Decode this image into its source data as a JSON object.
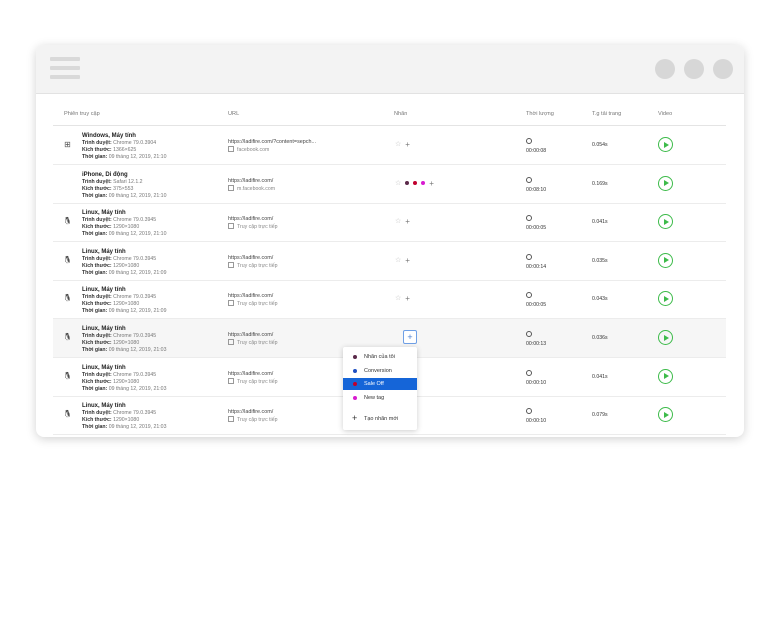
{
  "columns": [
    "Phiên truy cập",
    "URL",
    "Nhãn",
    "Thời lượng",
    "T.g tải trang",
    "Video"
  ],
  "rows": [
    {
      "os": "windows",
      "title": "Windows, Máy tính",
      "browser_label": "Trình duyệt:",
      "browser": "Chrome 79.0.3904",
      "size_label": "Kích thước:",
      "size": "1366×625",
      "time_label": "Thời gian:",
      "time": "09 tháng 12, 2019, 21:10",
      "url": "https://ladifire.com/?content=sepch...",
      "source": "facebook.com",
      "tags": [],
      "duration": "00:00:08",
      "load": "0.054s"
    },
    {
      "os": "apple",
      "title": "iPhone, Di động",
      "browser_label": "Trình duyệt:",
      "browser": "Safari 12.1.2",
      "size_label": "Kích thước:",
      "size": "375×553",
      "time_label": "Thời gian:",
      "time": "09 tháng 12, 2019, 21:10",
      "url": "https://ladifire.com/",
      "source": "m.facebook.com",
      "tags": [
        "#5b2a4a",
        "#c0002e",
        "#d81bd0"
      ],
      "duration": "00:08:10",
      "load": "0.169s"
    },
    {
      "os": "linux",
      "title": "Linux, Máy tính",
      "browser_label": "Trình duyệt:",
      "browser": "Chrome 79.0.3945",
      "size_label": "Kích thước:",
      "size": "1290×1080",
      "time_label": "Thời gian:",
      "time": "09 tháng 12, 2019, 21:10",
      "url": "https://ladifire.com/",
      "source": "Truy cập trực tiếp",
      "tags": [],
      "duration": "00:00:05",
      "load": "0.041s"
    },
    {
      "os": "linux",
      "title": "Linux, Máy tính",
      "browser_label": "Trình duyệt:",
      "browser": "Chrome 79.0.3945",
      "size_label": "Kích thước:",
      "size": "1290×1080",
      "time_label": "Thời gian:",
      "time": "09 tháng 12, 2019, 21:09",
      "url": "https://ladifire.com/",
      "source": "Truy cập trực tiếp",
      "tags": [],
      "duration": "00:00:14",
      "load": "0.035s"
    },
    {
      "os": "linux",
      "title": "Linux, Máy tính",
      "browser_label": "Trình duyệt:",
      "browser": "Chrome 79.0.3945",
      "size_label": "Kích thước:",
      "size": "1290×1080",
      "time_label": "Thời gian:",
      "time": "09 tháng 12, 2019, 21:09",
      "url": "https://ladifire.com/",
      "source": "Truy cập trực tiếp",
      "tags": [],
      "duration": "00:00:05",
      "load": "0.043s"
    },
    {
      "os": "linux",
      "title": "Linux, Máy tính",
      "browser_label": "Trình duyệt:",
      "browser": "Chrome 79.0.3945",
      "size_label": "Kích thước:",
      "size": "1290×1080",
      "time_label": "Thời gian:",
      "time": "09 tháng 12, 2019, 21:03",
      "url": "https://ladifire.com/",
      "source": "Truy cập trực tiếp",
      "tags": [],
      "duration": "00:00:13",
      "load": "0.036s",
      "highlighted": true
    },
    {
      "os": "linux",
      "title": "Linux, Máy tính",
      "browser_label": "Trình duyệt:",
      "browser": "Chrome 79.0.3945",
      "size_label": "Kích thước:",
      "size": "1290×1080",
      "time_label": "Thời gian:",
      "time": "09 tháng 12, 2019, 21:03",
      "url": "https://ladifire.com/",
      "source": "Truy cập trực tiếp",
      "tags": [],
      "duration": "00:00:10",
      "load": "0.041s"
    },
    {
      "os": "linux",
      "title": "Linux, Máy tính",
      "browser_label": "Trình duyệt:",
      "browser": "Chrome 79.0.3945",
      "size_label": "Kích thước:",
      "size": "1290×1080",
      "time_label": "Thời gian:",
      "time": "09 tháng 12, 2019, 21:03",
      "url": "https://ladifire.com/",
      "source": "Truy cập trực tiếp",
      "tags": [],
      "duration": "00:00:10",
      "load": "0.079s"
    }
  ],
  "dropdown": {
    "items": [
      {
        "label": "Nhãn của tôi",
        "color": "#5b2a4a",
        "selected": false
      },
      {
        "label": "Conversion",
        "color": "#1e4fc2",
        "selected": false
      },
      {
        "label": "Sale Off",
        "color": "#c0002e",
        "selected": true
      },
      {
        "label": "New tag",
        "color": "#d81bd0",
        "selected": false
      }
    ],
    "new_label": "Tạo nhãn mới"
  }
}
